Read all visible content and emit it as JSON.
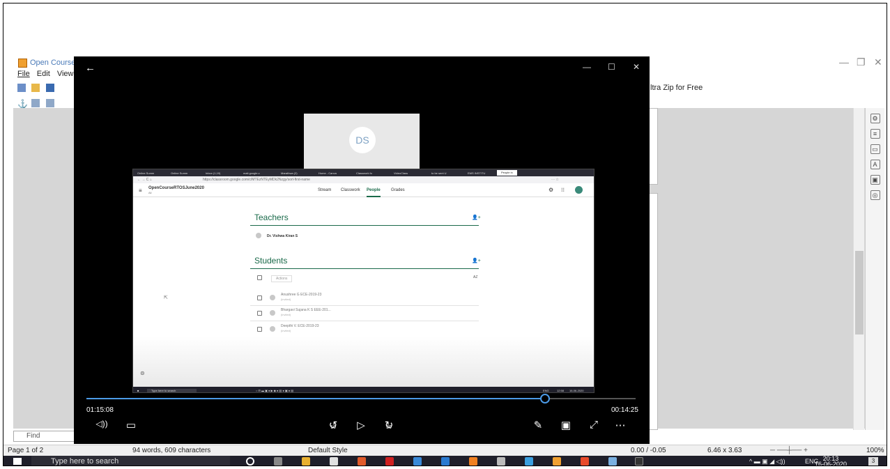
{
  "writer": {
    "title": "Open Course",
    "menu": [
      "File",
      "Edit",
      "View"
    ],
    "ad_text": "ltra Zip for Free",
    "find_placeholder": "Find",
    "status": {
      "page": "Page 1 of 2",
      "words": "94 words, 609 characters",
      "style": "Default Style",
      "position": "0.00 / -0.05",
      "size": "6.46 x 3.63",
      "zoom": "100%"
    }
  },
  "taskbar": {
    "search_placeholder": "Type here to search",
    "lang": "ENG",
    "time": "20:13",
    "date": "16-06-2020",
    "notifications": "3"
  },
  "player": {
    "elapsed": "01:15:08",
    "remaining": "00:14:25",
    "progress": 0.835,
    "skip_back": "10",
    "skip_forward": "30",
    "participant_initials": "DS"
  },
  "classroom": {
    "browser_tabs": [
      "Online Summ",
      "Online Summ",
      "Inbox (1,19)",
      "mail.google.c",
      "Marathwa (2)",
      "Home - Canva",
      "Classwork fo",
      "VideoClass",
      "to be sent U",
      "EMS INSTITU",
      "People in"
    ],
    "url": "https://classroom.google.com/c/MTEzNTEyMDk2Nzgy/sort-first-name",
    "class_name": "OpenCourseRTOSJune2020",
    "class_section": "All",
    "nav": [
      "Stream",
      "Classwork",
      "People",
      "Grades"
    ],
    "teachers_heading": "Teachers",
    "teacher": "Dr. Vishwa Kiran S",
    "students_heading": "Students",
    "actions_label": "Actions",
    "sort_label": "AZ",
    "students": [
      {
        "name": "Anushree G ECE-2019-23",
        "status": "(invited)"
      },
      {
        "name": "Bhargavi Sujana K S EEE-201...",
        "status": "(invited)"
      },
      {
        "name": "Deepthi V. ECE-2019-23",
        "status": "(invited)"
      }
    ],
    "inner_search": "Type here to search",
    "inner_lang": "ENG",
    "inner_time": "12:58",
    "inner_date": "16-06-2020"
  }
}
